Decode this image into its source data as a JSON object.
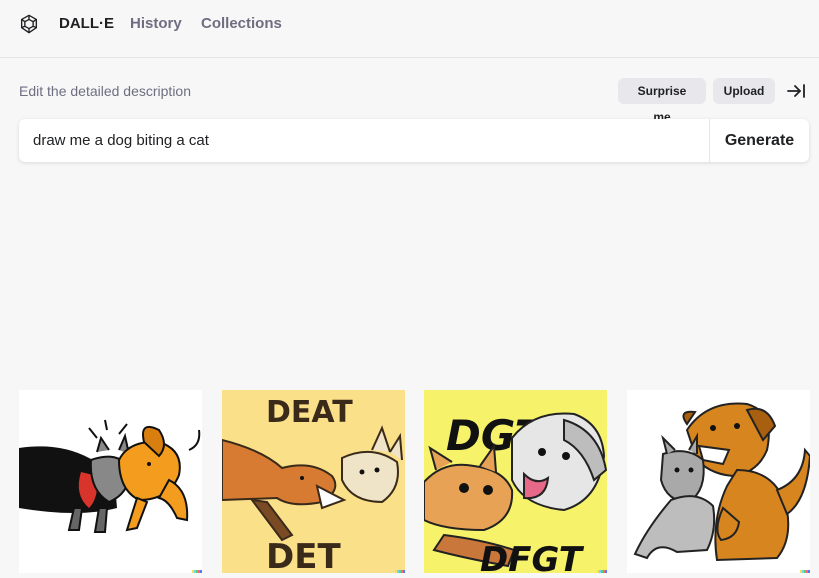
{
  "nav": {
    "brand": "DALL·E",
    "history": "History",
    "collections": "Collections"
  },
  "prompt": {
    "label": "Edit the detailed description",
    "surprise_label": "Surprise me",
    "upload_label": "Upload",
    "value": "draw me a dog biting a cat",
    "generate_label": "Generate"
  },
  "results": {
    "tile2": {
      "top_text": "DEAT",
      "bottom_text": "DET"
    },
    "tile3": {
      "top_text": "DGT",
      "bottom_text": "DFGT"
    }
  },
  "icons": {
    "logo": "openai-logo-icon",
    "collapse": "collapse-panel-icon"
  },
  "colors": {
    "background": "#f7f7f8",
    "text_primary": "#202123",
    "text_secondary": "#6e6e80",
    "pill_bg": "#e8e8ec"
  }
}
